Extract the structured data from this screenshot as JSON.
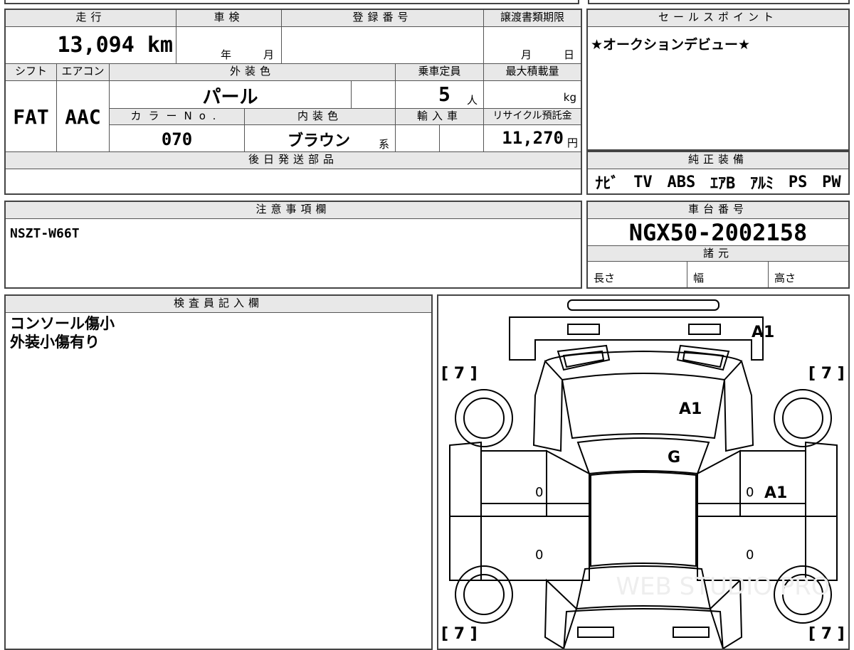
{
  "top_info": {
    "mileage_label": "走行",
    "mileage_value": "13,094 km",
    "inspection_label": "車検",
    "inspection_year": "年",
    "inspection_month": "月",
    "registration_label": "登録番号",
    "transfer_label": "譲渡書類期限",
    "transfer_month": "月",
    "transfer_day": "日",
    "shift_label": "シフト",
    "shift_value": "FAT",
    "aircon_label": "エアコン",
    "aircon_value": "AAC",
    "exterior_color_label": "外装色",
    "exterior_color_value": "パール",
    "capacity_label": "乗車定員",
    "capacity_value": "5",
    "capacity_unit": "人",
    "max_load_label": "最大積載量",
    "max_load_unit": "kg",
    "color_no_label": "カラーNo.",
    "color_no_value": "070",
    "interior_color_label": "内装色",
    "interior_color_value": "ブラウン",
    "interior_color_suffix": "系",
    "import_label": "輸入車",
    "recycle_label": "リサイクル預託金",
    "recycle_value": "11,270",
    "recycle_unit": "円",
    "later_parts_label": "後日発送部品"
  },
  "sales_point": {
    "label": "セールスポイント",
    "text": "★オークションデビュー★"
  },
  "genuine_equipment": {
    "label": "純正装備",
    "items": [
      "ﾅﾋﾞ",
      "TV",
      "ABS",
      "ｴｱB",
      "ｱﾙﾐ",
      "PS",
      "PW"
    ]
  },
  "notes": {
    "label": "注意事項欄",
    "text": "NSZT-W66T"
  },
  "chassis": {
    "label": "車台番号",
    "value": "NGX50-2002158",
    "specs_label": "諸元",
    "length_label": "長さ",
    "width_label": "幅",
    "height_label": "高さ"
  },
  "inspector": {
    "label": "検査員記入欄",
    "lines": [
      "コンソール傷小",
      "外装小傷有り"
    ]
  },
  "diagram": {
    "marks": {
      "front": "A1",
      "bonnet": "A1",
      "windshield": "G",
      "right_front_door": "A1"
    },
    "tire_depth": "[ 7 ]",
    "door_zero": "0",
    "watermark": "WEB STUDIO PRO"
  }
}
